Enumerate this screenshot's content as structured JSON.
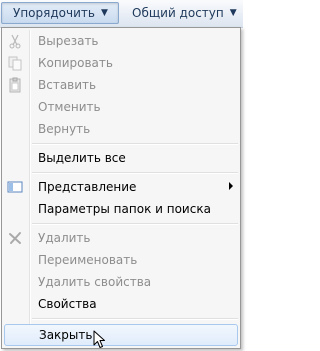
{
  "toolbar": {
    "organize_label": "Упорядочить",
    "share_label": "Общий доступ"
  },
  "menu": {
    "cut": "Вырезать",
    "copy": "Копировать",
    "paste": "Вставить",
    "undo": "Отменить",
    "redo": "Вернуть",
    "select_all": "Выделить все",
    "layout": "Представление",
    "folder_options": "Параметры папок и поиска",
    "delete": "Удалить",
    "rename": "Переименовать",
    "remove_properties": "Удалить свойства",
    "properties": "Свойства",
    "close": "Закрыть"
  },
  "icons": {
    "cut": "scissors-icon",
    "copy": "copy-icon",
    "paste": "clipboard-icon",
    "layout": "layout-pane-icon",
    "delete": "delete-x-icon",
    "submenu": "submenu-arrow-icon",
    "cursor": "mouse-pointer-icon"
  },
  "colors": {
    "disabled_text": "#8d8d8d",
    "hover_border": "#a8c8ee",
    "toolbar_text": "#1e395b"
  }
}
